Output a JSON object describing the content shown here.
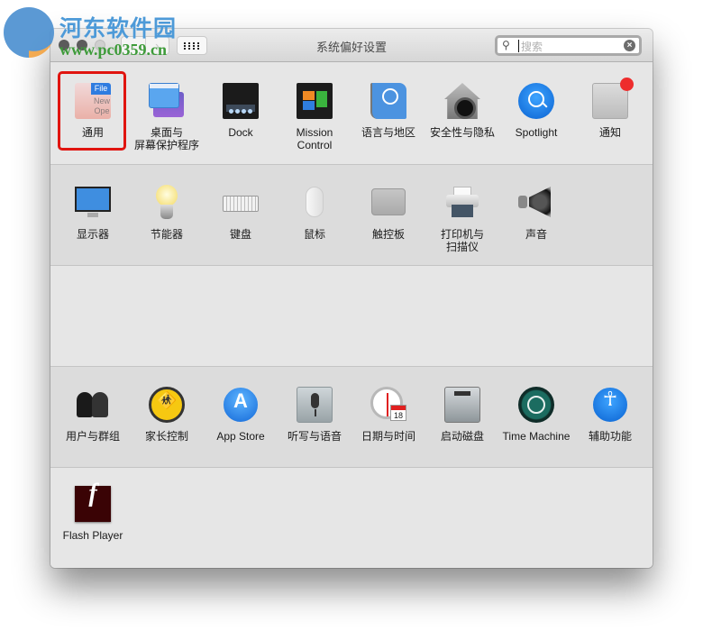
{
  "window": {
    "title": "系统偏好设置",
    "nav_back": "‹",
    "nav_forward": "›",
    "search": {
      "placeholder": "搜索",
      "value": ""
    },
    "icons": {
      "search": "magnifier-icon",
      "clear": "clear-icon"
    }
  },
  "watermark": {
    "name": "河东软件园",
    "url": "www.pc0359.cn"
  },
  "sections": [
    {
      "items": [
        {
          "id": "general",
          "label": "通用",
          "selected": true
        },
        {
          "id": "desktop",
          "label": "桌面与\n屏幕保护程序"
        },
        {
          "id": "dock",
          "label": "Dock"
        },
        {
          "id": "mission",
          "label": "Mission\nControl"
        },
        {
          "id": "language",
          "label": "语言与地区"
        },
        {
          "id": "security",
          "label": "安全性与隐私"
        },
        {
          "id": "spotlight",
          "label": "Spotlight"
        },
        {
          "id": "notifications",
          "label": "通知"
        }
      ]
    },
    {
      "items": [
        {
          "id": "displays",
          "label": "显示器"
        },
        {
          "id": "energy",
          "label": "节能器"
        },
        {
          "id": "keyboard",
          "label": "键盘"
        },
        {
          "id": "mouse",
          "label": "鼠标"
        },
        {
          "id": "trackpad",
          "label": "触控板"
        },
        {
          "id": "printers",
          "label": "打印机与\n扫描仪"
        },
        {
          "id": "sound",
          "label": "声音"
        }
      ]
    },
    {
      "items": []
    },
    {
      "items": [
        {
          "id": "users",
          "label": "用户与群组"
        },
        {
          "id": "parental",
          "label": "家长控制"
        },
        {
          "id": "appstore",
          "label": "App Store"
        },
        {
          "id": "dictation",
          "label": "听写与语音"
        },
        {
          "id": "datetime",
          "label": "日期与时间"
        },
        {
          "id": "startup",
          "label": "启动磁盘"
        },
        {
          "id": "timemachine",
          "label": "Time Machine"
        },
        {
          "id": "accessibility",
          "label": "辅助功能"
        }
      ]
    },
    {
      "items": [
        {
          "id": "flash",
          "label": "Flash Player"
        }
      ]
    }
  ],
  "general_icon": {
    "file": "File",
    "new": "New",
    "open": "Ope"
  },
  "datetime_icon": {
    "day": "18"
  }
}
